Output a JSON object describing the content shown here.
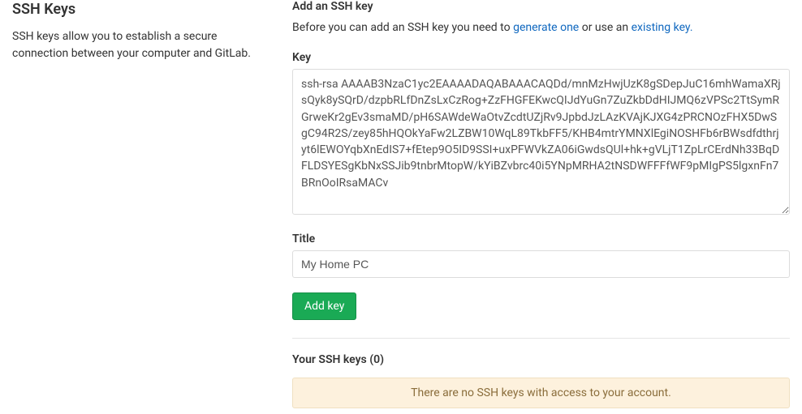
{
  "left": {
    "title": "SSH Keys",
    "description": "SSH keys allow you to establish a secure connection between your computer and GitLab."
  },
  "form": {
    "heading": "Add an SSH key",
    "help_prefix": "Before you can add an SSH key you need to ",
    "generate_link": "generate one",
    "help_mid": " or use an ",
    "existing_link": "existing key.",
    "key_label": "Key",
    "key_value": "ssh-rsa AAAAB3NzaC1yc2EAAAADAQABAAACAQDd/mnMzHwjUzK8gSDepJuC16mhWamaXRjsQyk8ySQrD/dzpbRLfDnZsLxCzRog+ZzFHGFEKwcQIJdYuGn7ZuZkbDdHIJMQ6zVPSc2TtSymRGrweKr2gEv3smaMD/pH6SAWdeWaOtvZcdtUZjRv9JpbdJzLAzKVAjKJXG4zPRCNOzFHX5DwSgC94R2S/zey85hHQOkYaFw2LZBW10WqL89TkbFF5/KHB4mtrYMNXlEgiNOSHFb6rBWsdfdthrjyt6lEWOYqbXnEdIS7+fEtep9O5ID9SSI+uxPFWVkZA06iGwdsQUl+hk+gVLjT1ZpLrCErdNh33BqDFLDSYESgKbNxSSJib9tnbrMtopW/kYiBZvbrc40i5YNpMRHA2tNSDWFFFfWF9pMIgPS5lgxnFn7BRnOoIRsaMACv",
    "title_label": "Title",
    "title_value": "My Home PC",
    "submit_label": "Add key"
  },
  "keys_list": {
    "heading_prefix": "Your SSH keys (",
    "count": "0",
    "heading_suffix": ")",
    "empty_message": "There are no SSH keys with access to your account."
  }
}
